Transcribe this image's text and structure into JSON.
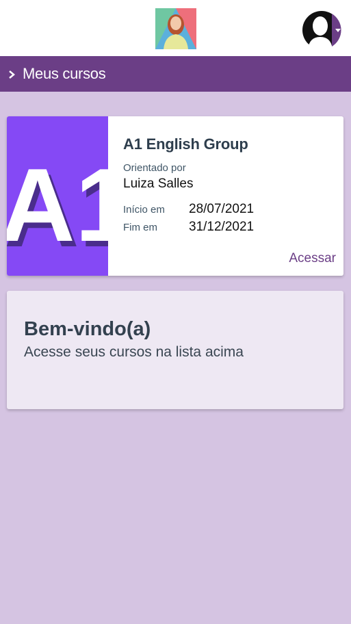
{
  "header": {
    "logo_icon": "instructor-photo",
    "avatar_icon": "user-avatar-icon",
    "avatar_dropdown_icon": "caret-down-icon",
    "nav_title": "Meus cursos"
  },
  "course": {
    "thumbnail_text": "A1",
    "title": "A1 English Group",
    "mentor_label": "Orientado por",
    "mentor_name": "Luiza Salles",
    "start_label": "Início em",
    "start_date": "28/07/2021",
    "end_label": "Fim em",
    "end_date": "31/12/2021",
    "access_label": "Acessar"
  },
  "welcome": {
    "title": "Bem-vindo(a)",
    "subtitle": "Acesse seus cursos na lista acima"
  },
  "colors": {
    "brand_purple": "#6b3e86",
    "thumb_purple": "#8549f5",
    "background": "#d5c4e2"
  }
}
